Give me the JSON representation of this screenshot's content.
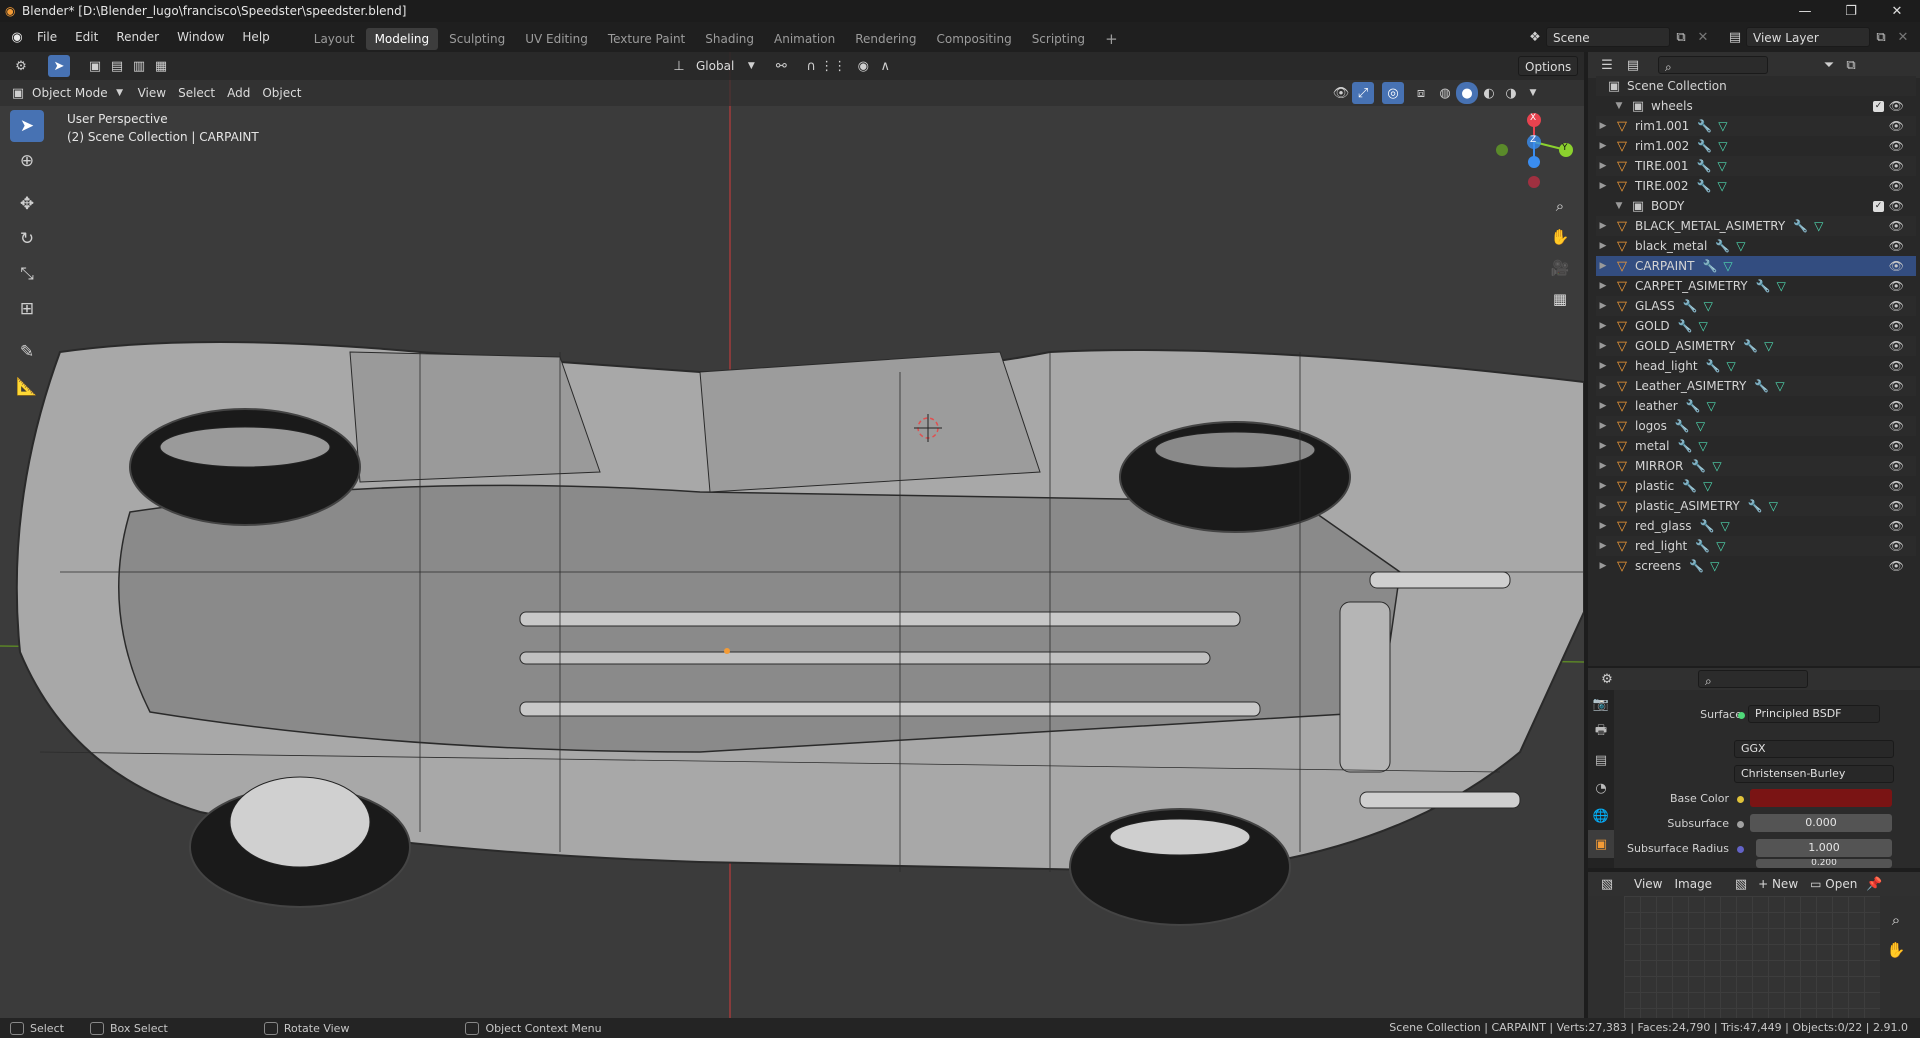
{
  "window": {
    "title": "Blender* [D:\\Blender_lugo\\francisco\\Speedster\\speedster.blend]"
  },
  "menubar": {
    "items": [
      "File",
      "Edit",
      "Render",
      "Window",
      "Help"
    ],
    "workspaces": [
      "Layout",
      "Modeling",
      "Sculpting",
      "UV Editing",
      "Texture Paint",
      "Shading",
      "Animation",
      "Rendering",
      "Compositing",
      "Scripting"
    ],
    "active_workspace": "Modeling",
    "scene": "Scene",
    "view_layer": "View Layer"
  },
  "viewport": {
    "mode": "Object Mode",
    "menus": [
      "View",
      "Select",
      "Add",
      "Object"
    ],
    "orientation": "Global",
    "options": "Options",
    "perspective_label": "User Perspective",
    "collection_label": "(2) Scene Collection | CARPAINT",
    "gizmo": {
      "x": "X",
      "y": "Y",
      "z": "Z"
    }
  },
  "outliner": {
    "root": "Scene Collection",
    "collections": [
      {
        "name": "wheels",
        "objects": [
          {
            "name": "rim1.001"
          },
          {
            "name": "rim1.002"
          },
          {
            "name": "TIRE.001"
          },
          {
            "name": "TIRE.002"
          }
        ]
      },
      {
        "name": "BODY",
        "objects": [
          {
            "name": "BLACK_METAL_ASIMETRY"
          },
          {
            "name": "black_metal"
          },
          {
            "name": "CARPAINT",
            "active": true
          },
          {
            "name": "CARPET_ASIMETRY"
          },
          {
            "name": "GLASS"
          },
          {
            "name": "GOLD"
          },
          {
            "name": "GOLD_ASIMETRY"
          },
          {
            "name": "head_light"
          },
          {
            "name": "Leather_ASIMETRY"
          },
          {
            "name": "leather"
          },
          {
            "name": "logos"
          },
          {
            "name": "metal"
          },
          {
            "name": "MIRROR"
          },
          {
            "name": "plastic"
          },
          {
            "name": "plastic_ASIMETRY"
          },
          {
            "name": "red_glass"
          },
          {
            "name": "red_light"
          },
          {
            "name": "screens"
          }
        ]
      }
    ]
  },
  "properties": {
    "surface_label": "Surface",
    "surface_value": "Principled BSDF",
    "distribution": "GGX",
    "subsurface_method": "Christensen-Burley",
    "base_color_label": "Base Color",
    "base_color": "#7a1414",
    "subsurface_label": "Subsurface",
    "subsurface_value": "0.000",
    "subsurface_radius_label": "Subsurface Radius",
    "subsurface_radius_value": "1.000",
    "subsurface_radius_value2": "0.200"
  },
  "image_editor": {
    "menus": [
      "View",
      "Image"
    ],
    "new_label": "New",
    "open_label": "Open"
  },
  "statusbar": {
    "select": "Select",
    "box_select": "Box Select",
    "rotate_view": "Rotate View",
    "context_menu": "Object Context Menu",
    "stats": "Scene Collection | CARPAINT | Verts:27,383 | Faces:24,790 | Tris:47,449 | Objects:0/22 | 2.91.0"
  },
  "colors": {
    "accent": "#4772b3",
    "object_icon": "#f39b36",
    "modifier_icon": "#6aa6e6",
    "mesh_icon": "#4fd8b0",
    "axis_x": "#e8434f",
    "axis_y": "#8bd12e",
    "axis_z": "#3a8df0"
  }
}
